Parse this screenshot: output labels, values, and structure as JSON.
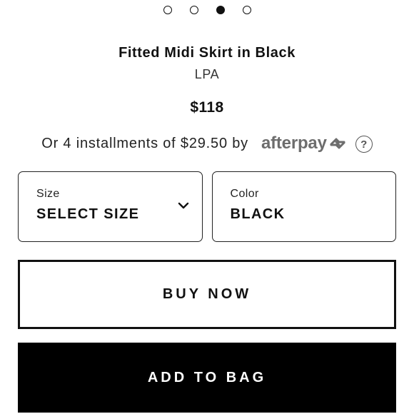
{
  "carousel": {
    "dots": [
      {
        "active": false,
        "icon": "carousel-dot-icon"
      },
      {
        "active": false,
        "icon": "carousel-dot-icon"
      },
      {
        "active": true,
        "icon": "carousel-dot-icon"
      },
      {
        "active": false,
        "icon": "carousel-dot-icon"
      }
    ]
  },
  "product": {
    "title": "Fitted Midi Skirt in Black",
    "brand": "LPA",
    "price": "$118"
  },
  "installments": {
    "text": "Or 4 installments of $29.50 by",
    "provider": "afterpay",
    "provider_icon": "afterpay-arrows-icon",
    "help_icon": "question-circle-icon",
    "help_glyph": "?"
  },
  "size": {
    "label": "Size",
    "value": "SELECT SIZE",
    "icon": "chevron-down-icon"
  },
  "color": {
    "label": "Color",
    "value": "BLACK"
  },
  "actions": {
    "buy_now": "BUY NOW",
    "add_to_bag": "ADD TO BAG"
  },
  "colors": {
    "primary": "#000000",
    "text": "#111111",
    "afterpay_gray": "#6d6d6d",
    "border": "#222222",
    "background": "#ffffff"
  }
}
